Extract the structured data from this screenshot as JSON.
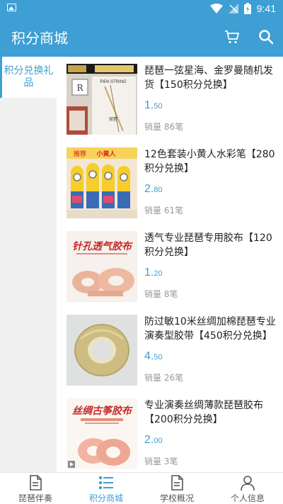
{
  "status": {
    "time": "9:41"
  },
  "header": {
    "title": "积分商城"
  },
  "sidebar": {
    "categories": [
      {
        "label": "积分兑换礼品"
      }
    ]
  },
  "products": [
    {
      "name": "琵琶一弦星海、金罗曼随机发货【150积分兑换】",
      "price_int": "1.",
      "price_dec": "50",
      "sales": "销量 86笔",
      "image_text": "金罗曼 PIPA STRING 琵琶"
    },
    {
      "name": "12色套装小黄人水彩笔【280积分兑换】",
      "price_int": "2.",
      "price_dec": "80",
      "sales": "销量 61笔",
      "image_text": "推荐 小黄人 水彩笔"
    },
    {
      "name": "透气专业琵琶专用胶布【120积分兑换】",
      "price_int": "1.",
      "price_dec": "20",
      "sales": "销量 8笔",
      "image_text": "针孔透气胶布"
    },
    {
      "name": "防过敏10米丝绸加棉琵琶专业演奏型胶带【450积分兑换】",
      "price_int": "4.",
      "price_dec": "50",
      "sales": "销量 26笔",
      "image_text": ""
    },
    {
      "name": "专业演奏丝绸薄款琵琶胶布【200积分兑换】",
      "price_int": "2.",
      "price_dec": "00",
      "sales": "销量 3笔",
      "image_text": "丝绸古筝胶布"
    }
  ],
  "tabbar": [
    {
      "label": "琵琶伴奏",
      "icon": "document-icon"
    },
    {
      "label": "积分商城",
      "icon": "list-icon"
    },
    {
      "label": "学校概况",
      "icon": "document-icon"
    },
    {
      "label": "个人信息",
      "icon": "person-icon"
    }
  ],
  "colors": {
    "primary": "#3d9fd3",
    "sidebar_bg": "#f0f0f0"
  }
}
